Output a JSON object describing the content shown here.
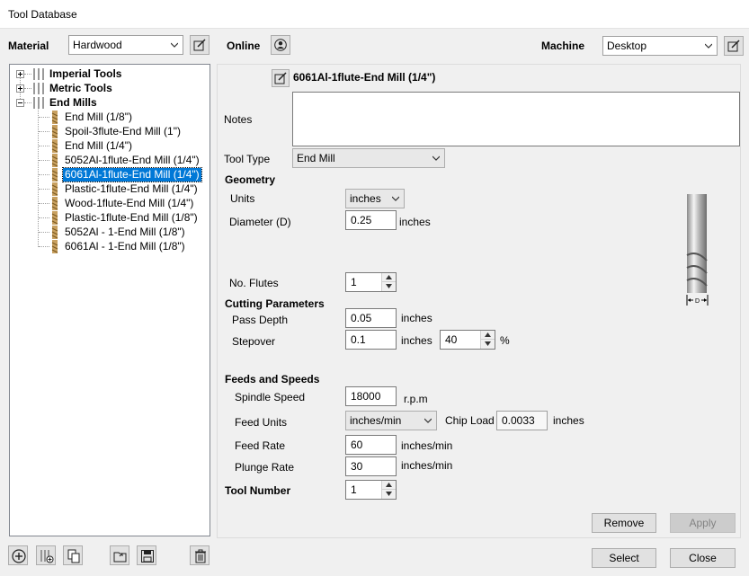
{
  "window": {
    "title": "Tool Database"
  },
  "material": {
    "label": "Material",
    "value": "Hardwood"
  },
  "online": {
    "label": "Online"
  },
  "machine": {
    "label": "Machine",
    "value": "Desktop"
  },
  "tree": {
    "groups": [
      {
        "label": "Imperial Tools",
        "expanded": false
      },
      {
        "label": "Metric Tools",
        "expanded": false
      },
      {
        "label": "End Mills",
        "expanded": true
      }
    ],
    "items": [
      "End Mill (1/8\")",
      "Spoil-3flute-End Mill (1\")",
      "End Mill (1/4\")",
      "5052Al-1flute-End Mill (1/4\")",
      "6061Al-1flute-End Mill (1/4\")",
      "Plastic-1flute-End Mill (1/4\")",
      "Wood-1flute-End Mill (1/4\")",
      "Plastic-1flute-End Mill (1/8\")",
      "5052Al - 1-End Mill (1/8\")",
      "6061Al - 1-End Mill (1/8\")"
    ],
    "selected_index": 4
  },
  "tool": {
    "name": "6061Al-1flute-End Mill (1/4\")",
    "notes_label": "Notes",
    "notes": "",
    "type_label": "Tool Type",
    "type_value": "End Mill"
  },
  "geometry": {
    "heading": "Geometry",
    "units_label": "Units",
    "units_value": "inches",
    "diameter_label": "Diameter (D)",
    "diameter_value": "0.25",
    "diameter_unit": "inches",
    "flutes_label": "No. Flutes",
    "flutes_value": "1",
    "diagram_label": "D"
  },
  "cutting": {
    "heading": "Cutting Parameters",
    "pass_depth_label": "Pass Depth",
    "pass_depth_value": "0.05",
    "pass_depth_unit": "inches",
    "stepover_label": "Stepover",
    "stepover_value": "0.1",
    "stepover_unit": "inches",
    "stepover_pct": "40",
    "pct_symbol": "%"
  },
  "feeds": {
    "heading": "Feeds and Speeds",
    "spindle_label": "Spindle Speed",
    "spindle_value": "18000",
    "spindle_unit": "r.p.m",
    "feed_units_label": "Feed Units",
    "feed_units_value": "inches/min",
    "chip_load_label": "Chip Load",
    "chip_load_value": "0.0033",
    "chip_load_unit": "inches",
    "feed_rate_label": "Feed Rate",
    "feed_rate_value": "60",
    "feed_rate_unit": "inches/min",
    "plunge_label": "Plunge Rate",
    "plunge_value": "30",
    "plunge_unit": "inches/min"
  },
  "tool_number": {
    "label": "Tool Number",
    "value": "1"
  },
  "buttons": {
    "remove": "Remove",
    "apply": "Apply",
    "select": "Select",
    "close": "Close"
  },
  "colors": {
    "selection": "#0078d7",
    "window_bg": "#f0f0f0",
    "tool_bit": "#c8a060"
  }
}
